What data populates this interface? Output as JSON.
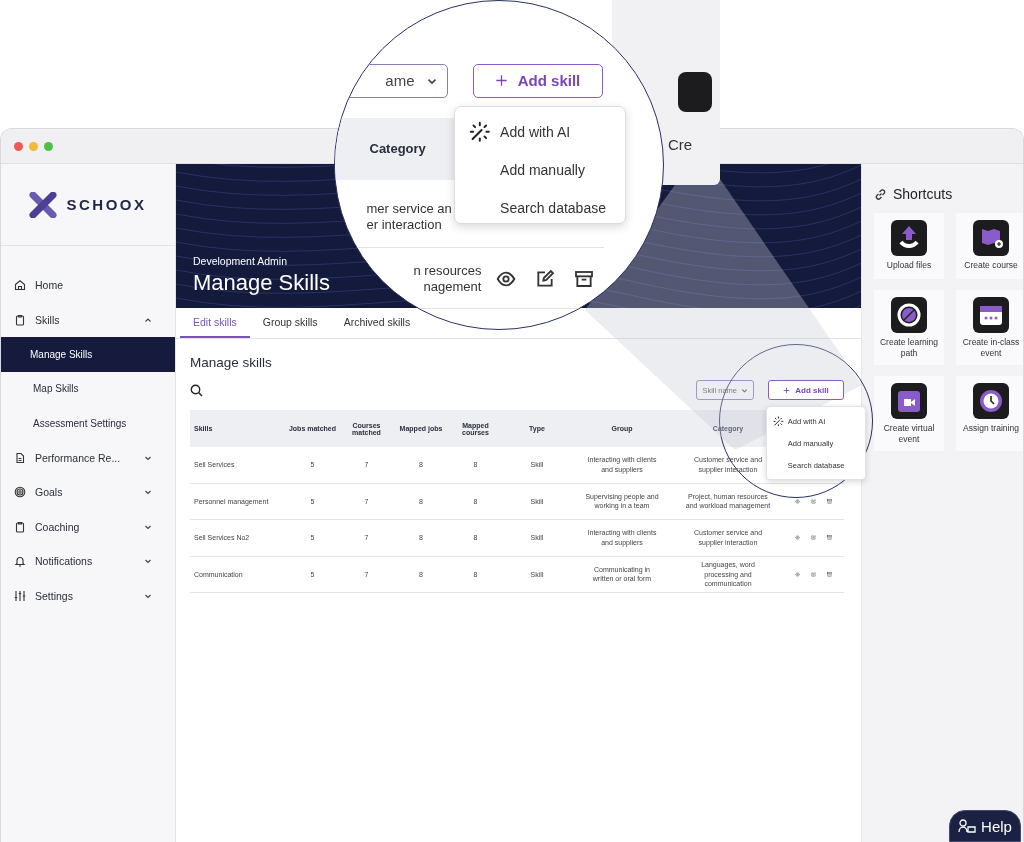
{
  "sidebar": {
    "logo": "SCHOOX",
    "items": [
      {
        "label": "Home",
        "kind": "link",
        "selected": false
      },
      {
        "label": "Skills",
        "kind": "group",
        "expanded": true,
        "selected": false,
        "children": [
          {
            "label": "Manage Skills",
            "selected": true
          },
          {
            "label": "Map Skills",
            "selected": false
          },
          {
            "label": "Assessment Settings",
            "selected": false
          }
        ]
      },
      {
        "label": "Performance Re...",
        "kind": "group",
        "expanded": false,
        "selected": false
      },
      {
        "label": "Goals",
        "kind": "group",
        "expanded": false,
        "selected": false
      },
      {
        "label": "Coaching",
        "kind": "group",
        "expanded": false,
        "selected": false
      },
      {
        "label": "Notifications",
        "kind": "group",
        "expanded": false,
        "selected": false
      },
      {
        "label": "Settings",
        "kind": "group",
        "expanded": false,
        "selected": false
      }
    ]
  },
  "header": {
    "subtitle": "Development Admin",
    "title": "Manage Skills"
  },
  "tabs": [
    {
      "label": "Edit skills",
      "selected": true
    },
    {
      "label": "Group skills",
      "selected": false
    },
    {
      "label": "Archived skills",
      "selected": false
    }
  ],
  "section_title": "Manage skills",
  "filter": {
    "value": "Skill name"
  },
  "add_button": "Add skill",
  "add_menu": [
    {
      "label": "Add with AI",
      "kind": "ai"
    },
    {
      "label": "Add manually",
      "kind": "plain"
    },
    {
      "label": "Search database",
      "kind": "plain"
    }
  ],
  "table": {
    "columns": [
      "Skills",
      "Jobs matched",
      "Courses matched",
      "Mapped jobs",
      "Mapped courses",
      "Type",
      "Group",
      "Category"
    ],
    "rows": [
      {
        "cells": [
          "Sell Services",
          "5",
          "7",
          "8",
          "8",
          "Skill",
          "Interacting with clients and suppliers",
          "Customer service and supplier interaction"
        ]
      },
      {
        "cells": [
          "Personnel management",
          "5",
          "7",
          "8",
          "8",
          "Skill",
          "Supervising people and working in a team",
          "Project, human resources and workload management"
        ],
        "actions": true
      },
      {
        "cells": [
          "Sell Services No2",
          "5",
          "7",
          "8",
          "8",
          "Skill",
          "Interacting with clients and suppliers",
          "Customer service and supplier interaction"
        ],
        "actions": true
      },
      {
        "cells": [
          "Communication",
          "5",
          "7",
          "8",
          "8",
          "Skill",
          "Communicating in written or oral form",
          "Languages, word processing and communication"
        ],
        "actions": true
      }
    ]
  },
  "shortcuts": {
    "title": "Shortcuts",
    "items": [
      {
        "label": "Upload files"
      },
      {
        "label": "Create course"
      },
      {
        "label": "Create learning path"
      },
      {
        "label": "Create in-class event"
      },
      {
        "label": "Create virtual event"
      },
      {
        "label": "Assign training"
      }
    ]
  },
  "help_button": "Help",
  "background_card": {
    "label": "Cre"
  },
  "magnifier": {
    "filter_value": "ame",
    "add_button": "Add skill",
    "menu": [
      {
        "label": "Add with AI",
        "kind": "ai"
      },
      {
        "label": "Add manually",
        "kind": "plain"
      },
      {
        "label": "Search database",
        "kind": "plain"
      }
    ],
    "column": "Category",
    "rows": [
      {
        "lines": [
          "mer service an",
          "er interaction"
        ]
      },
      {
        "lines": [
          "n resources",
          "nagement"
        ],
        "actions": true
      }
    ]
  }
}
